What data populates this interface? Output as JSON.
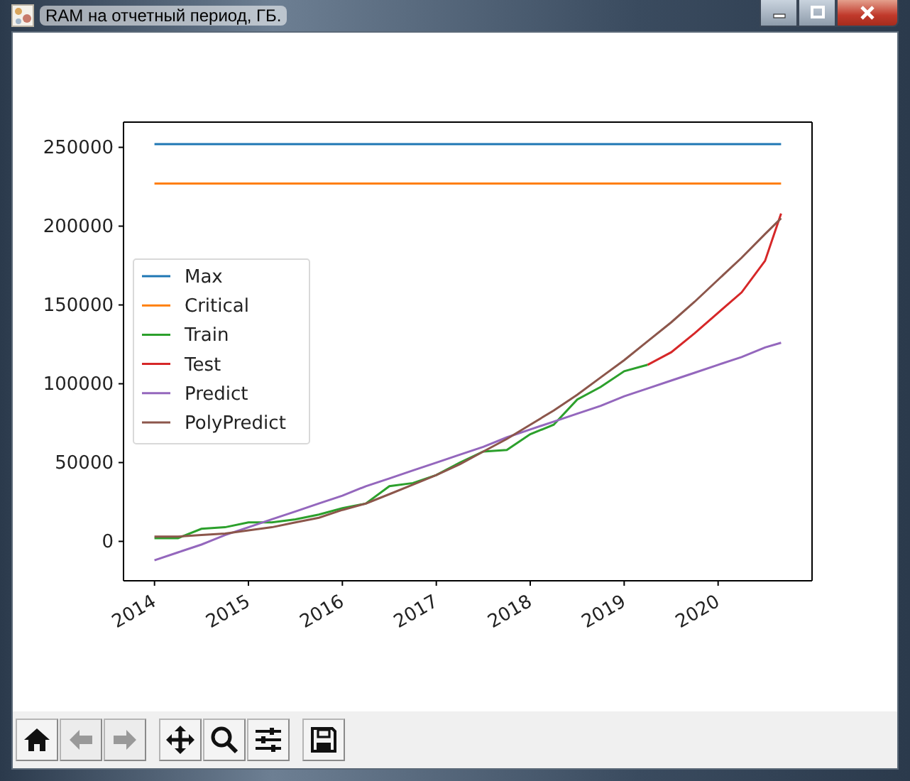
{
  "window": {
    "title": "RAM на отчетный период, ГБ."
  },
  "figure": {
    "chart_data": {
      "type": "line",
      "x": [
        2014,
        2014.25,
        2014.5,
        2014.75,
        2015,
        2015.25,
        2015.5,
        2015.75,
        2016,
        2016.25,
        2016.5,
        2016.75,
        2017,
        2017.25,
        2017.5,
        2017.75,
        2018,
        2018.25,
        2018.5,
        2018.75,
        2019,
        2019.25,
        2019.5,
        2019.75,
        2020,
        2020.25,
        2020.5,
        2020.67
      ],
      "series": [
        {
          "name": "Max",
          "color": "#1f77b4",
          "values": [
            252000,
            252000,
            252000,
            252000,
            252000,
            252000,
            252000,
            252000,
            252000,
            252000,
            252000,
            252000,
            252000,
            252000,
            252000,
            252000,
            252000,
            252000,
            252000,
            252000,
            252000,
            252000,
            252000,
            252000,
            252000,
            252000,
            252000,
            252000
          ]
        },
        {
          "name": "Critical",
          "color": "#ff7f0e",
          "values": [
            227000,
            227000,
            227000,
            227000,
            227000,
            227000,
            227000,
            227000,
            227000,
            227000,
            227000,
            227000,
            227000,
            227000,
            227000,
            227000,
            227000,
            227000,
            227000,
            227000,
            227000,
            227000,
            227000,
            227000,
            227000,
            227000,
            227000,
            227000
          ]
        },
        {
          "name": "Train",
          "color": "#2ca02c",
          "values": [
            2000,
            2000,
            8000,
            9000,
            12000,
            12000,
            14000,
            17000,
            21000,
            24000,
            35000,
            37000,
            42000,
            50000,
            57000,
            58000,
            68000,
            74000,
            90000,
            98000,
            108000,
            112000,
            null,
            null,
            null,
            null,
            null,
            null
          ]
        },
        {
          "name": "Test",
          "color": "#d62728",
          "values": [
            null,
            null,
            null,
            null,
            null,
            null,
            null,
            null,
            null,
            null,
            null,
            null,
            null,
            null,
            null,
            null,
            null,
            null,
            null,
            null,
            null,
            112000,
            120000,
            132000,
            145000,
            158000,
            178000,
            208000
          ]
        },
        {
          "name": "Predict",
          "color": "#9467bd",
          "values": [
            -12000,
            -7000,
            -2000,
            4000,
            9000,
            14000,
            19000,
            24000,
            29000,
            35000,
            40000,
            45000,
            50000,
            55000,
            60000,
            66000,
            71000,
            76000,
            81000,
            86000,
            92000,
            97000,
            102000,
            107000,
            112000,
            117000,
            123000,
            126000
          ]
        },
        {
          "name": "PolyPredict",
          "color": "#8c564b",
          "values": [
            3000,
            3000,
            4000,
            5000,
            7000,
            9000,
            12000,
            15000,
            20000,
            24000,
            30000,
            36000,
            42000,
            49000,
            57000,
            65000,
            74000,
            83000,
            93000,
            104000,
            115000,
            127000,
            139000,
            152000,
            166000,
            180000,
            195000,
            205000
          ]
        }
      ],
      "xlim": [
        2013.67,
        2021.0
      ],
      "ylim": [
        -25000,
        266000
      ],
      "xticks": [
        2014,
        2015,
        2016,
        2017,
        2018,
        2019,
        2020
      ],
      "yticks": [
        0,
        50000,
        100000,
        150000,
        200000,
        250000
      ],
      "legend": true
    }
  },
  "toolbar": [
    {
      "kind": "home",
      "disabled": false
    },
    {
      "kind": "back",
      "disabled": true
    },
    {
      "kind": "forward",
      "disabled": true
    },
    {
      "kind": "pan",
      "disabled": false
    },
    {
      "kind": "zoom",
      "disabled": false
    },
    {
      "kind": "configure",
      "disabled": false
    },
    {
      "kind": "save",
      "disabled": false
    }
  ]
}
